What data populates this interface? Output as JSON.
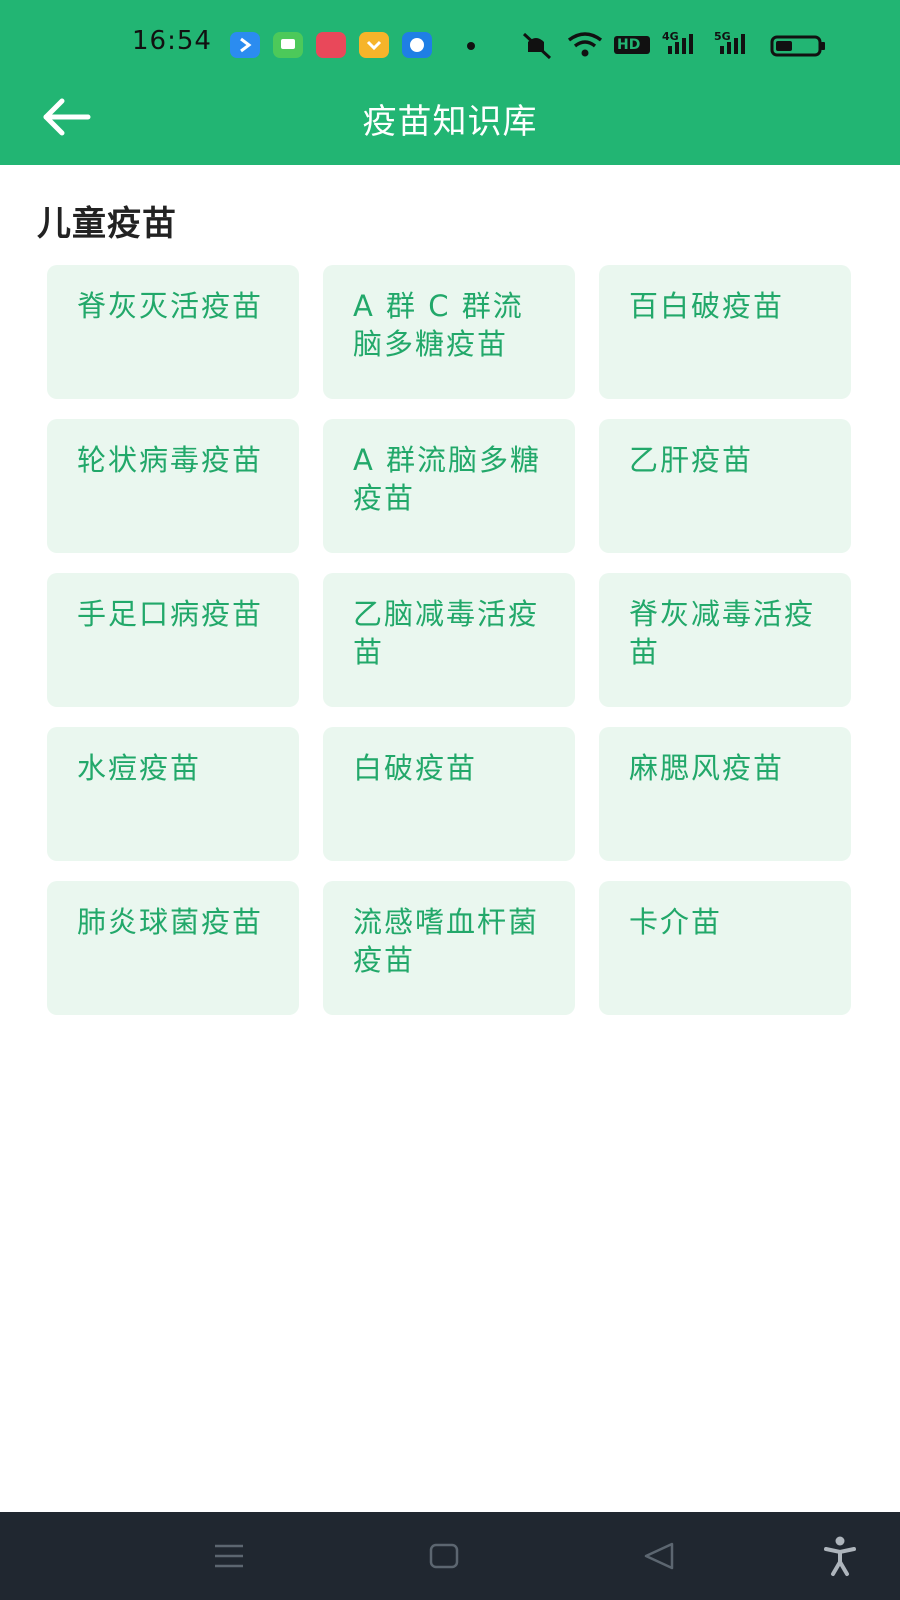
{
  "status": {
    "time": "16:54",
    "hd_label": "HD",
    "network_4g": "4G",
    "network_5g": "5G",
    "app_icons": [
      "arrow-app-icon",
      "message-app-icon",
      "shop-app-icon",
      "wallet-app-icon",
      "browser-app-icon"
    ]
  },
  "toolbar": {
    "title": "疫苗知识库",
    "back_icon": "back-arrow-icon"
  },
  "section": {
    "title": "儿童疫苗"
  },
  "vaccines": [
    "脊灰灭活疫苗",
    "A 群 C 群流脑多糖疫苗",
    "百白破疫苗",
    "轮状病毒疫苗",
    "A 群流脑多糖疫苗",
    "乙肝疫苗",
    "手足口病疫苗",
    "乙脑减毒活疫苗",
    "脊灰减毒活疫苗",
    "水痘疫苗",
    "白破疫苗",
    "麻腮风疫苗",
    "肺炎球菌疫苗",
    "流感嗜血杆菌疫苗",
    "卡介苗"
  ],
  "colors": {
    "header": "#22b573",
    "card_bg": "#eaf7ef",
    "card_text": "#22a86a",
    "nav_bar": "#202730"
  },
  "nav": {
    "icons": [
      "menu-icon",
      "home-square-icon",
      "back-triangle-icon",
      "accessibility-icon"
    ]
  }
}
